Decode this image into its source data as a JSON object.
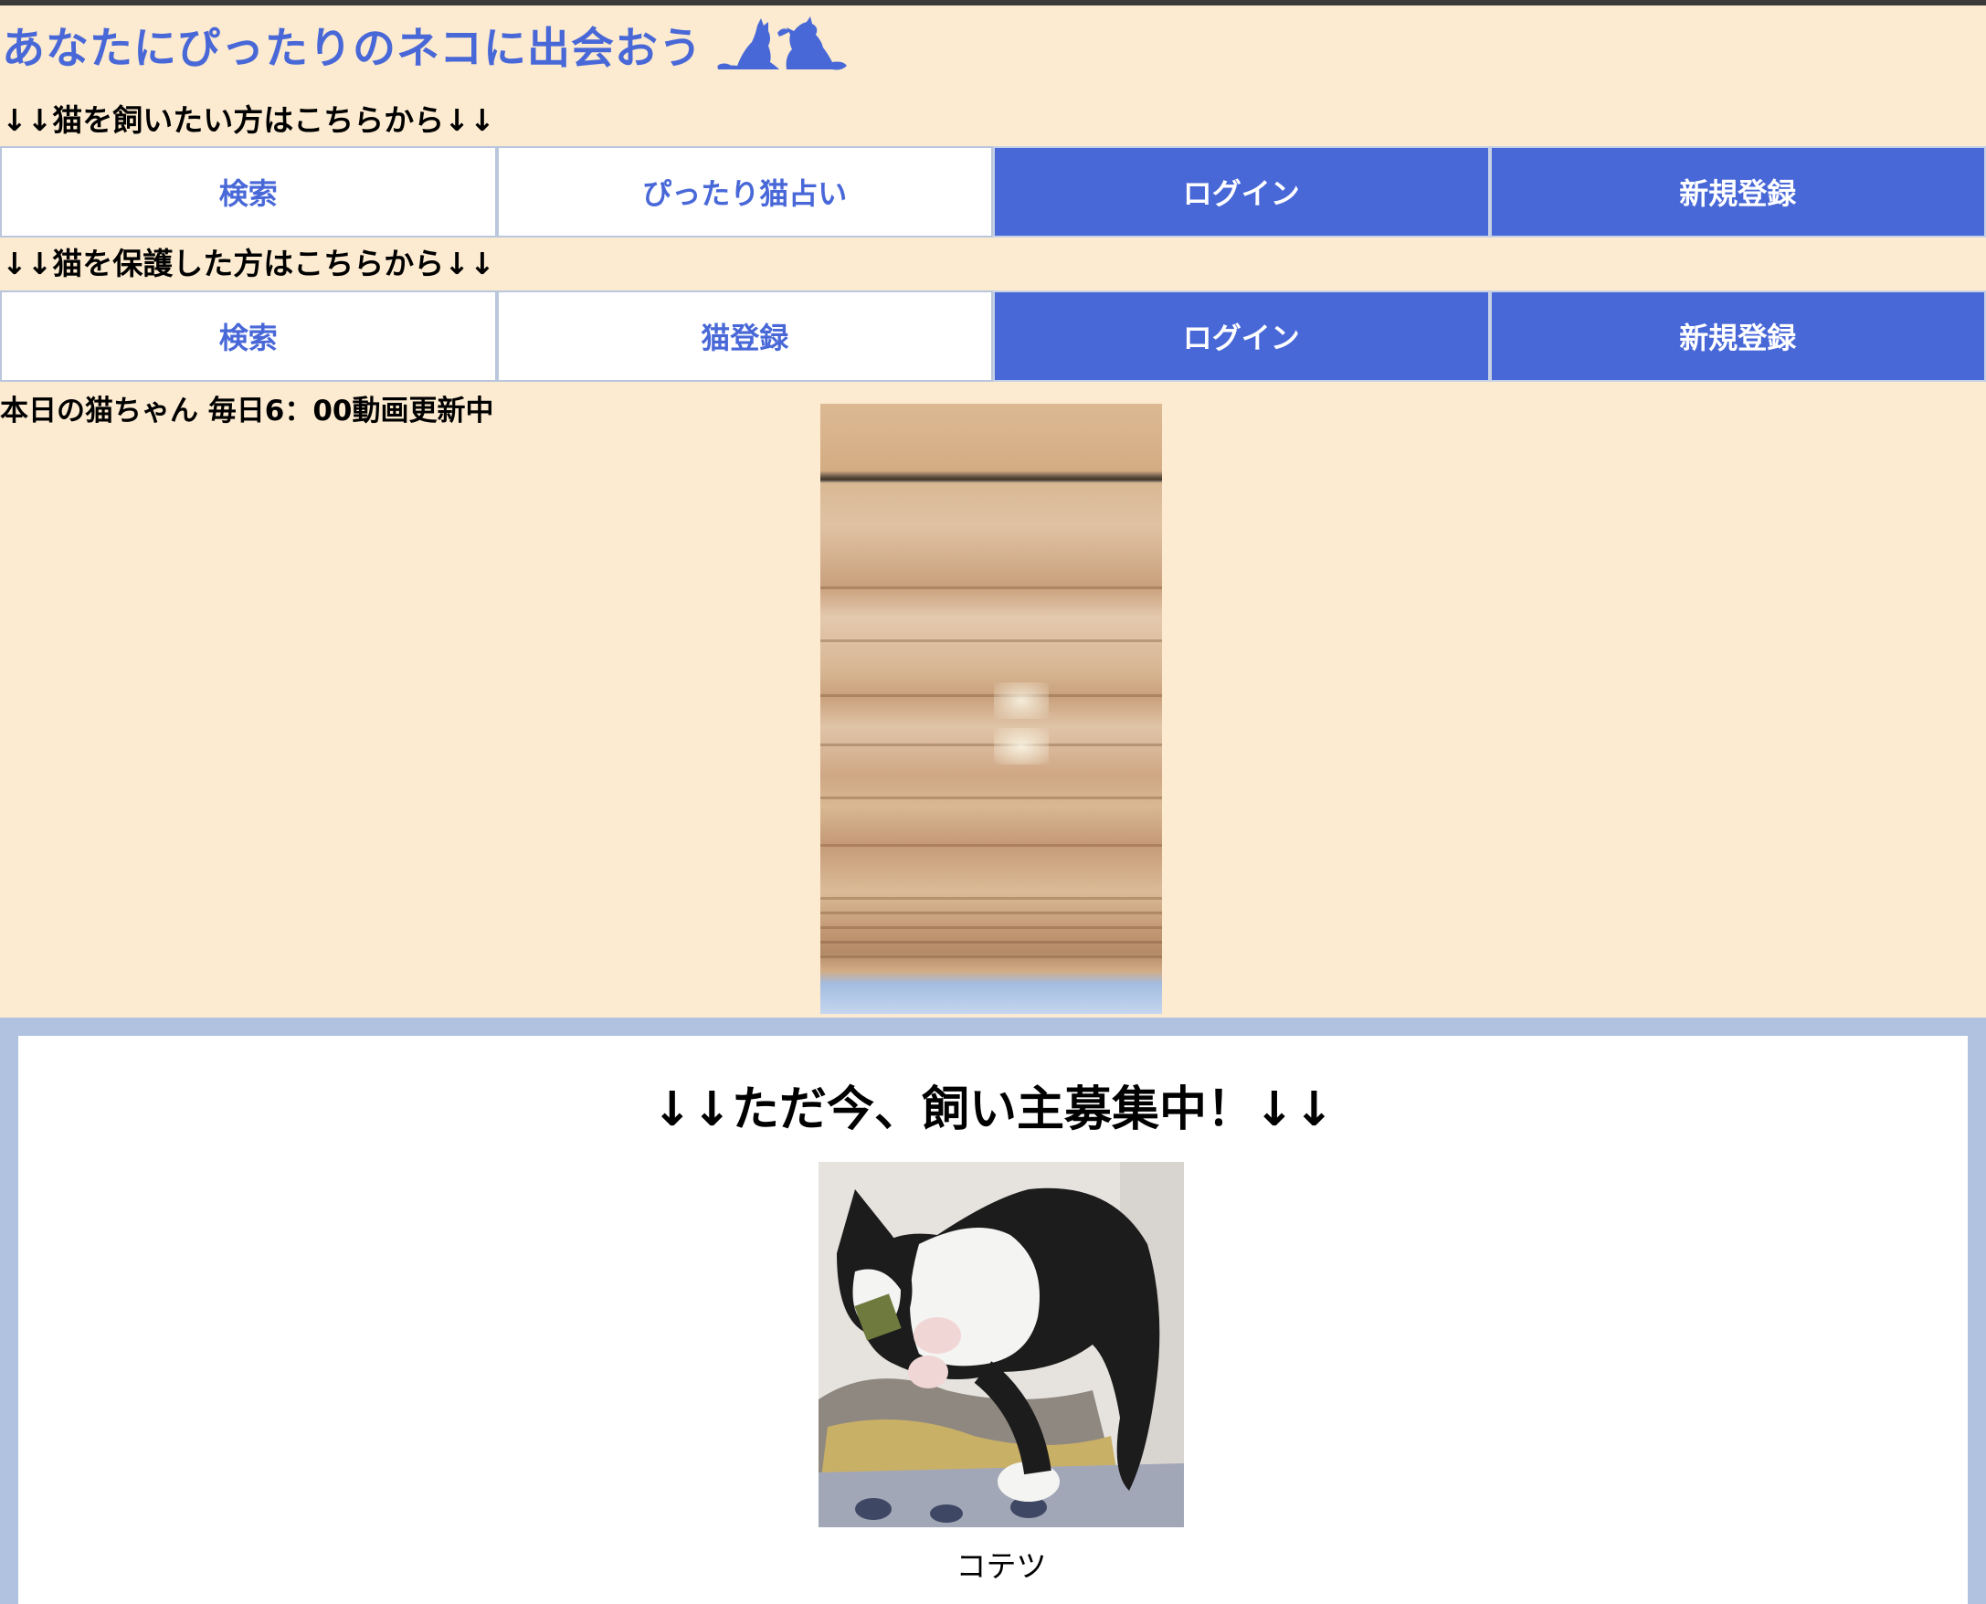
{
  "header": {
    "title": "あなたにぴったりのネコに出会おう",
    "logo_icon": "cats-silhouette-icon"
  },
  "adopter_section": {
    "label": "↓↓猫を飼いたい方はこちらから↓↓",
    "buttons": [
      {
        "label": "検索",
        "style": "light"
      },
      {
        "label": "ぴったり猫占い",
        "style": "light"
      },
      {
        "label": "ログイン",
        "style": "dark"
      },
      {
        "label": "新規登録",
        "style": "dark"
      }
    ]
  },
  "rescuer_section": {
    "label": "↓↓猫を保護した方はこちらから↓↓",
    "buttons": [
      {
        "label": "検索",
        "style": "light"
      },
      {
        "label": "猫登録",
        "style": "light"
      },
      {
        "label": "ログイン",
        "style": "dark"
      },
      {
        "label": "新規登録",
        "style": "dark"
      }
    ]
  },
  "today": {
    "label": "本日の猫ちゃん 毎日6：00動画更新中"
  },
  "recruit": {
    "title": "↓↓ただ今、飼い主募集中！↓↓",
    "cats": [
      {
        "name": "コテツ"
      }
    ]
  },
  "colors": {
    "accent": "#4968d8",
    "background": "#fcebd0",
    "frame": "#b0c2e0"
  }
}
